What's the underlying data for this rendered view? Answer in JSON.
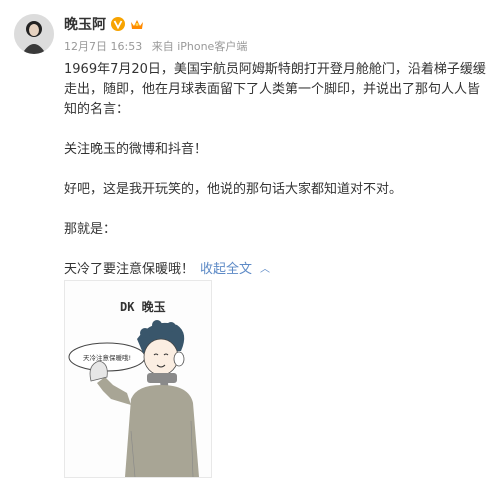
{
  "post": {
    "author": "晚玉阿",
    "date": "12月7日 16:53",
    "source": "来自 iPhone客户端",
    "paragraphs": [
      "1969年7月20日，美国宇航员阿姆斯特朗打开登月舱舱门，沿着梯子缓缓走出，随即，他在月球表面留下了人类第一个脚印，并说出了那句人人皆知的名言：",
      "关注晚玉的微博和抖音！",
      "好吧，这是我开玩笑的，他说的那句话大家都知道对不对。",
      "那就是：",
      "天冷了要注意保暖哦！"
    ],
    "collapse_label": "收起全文"
  },
  "image": {
    "title": "DK 晚玉",
    "bubble": "天冷注意保暖哦!"
  }
}
